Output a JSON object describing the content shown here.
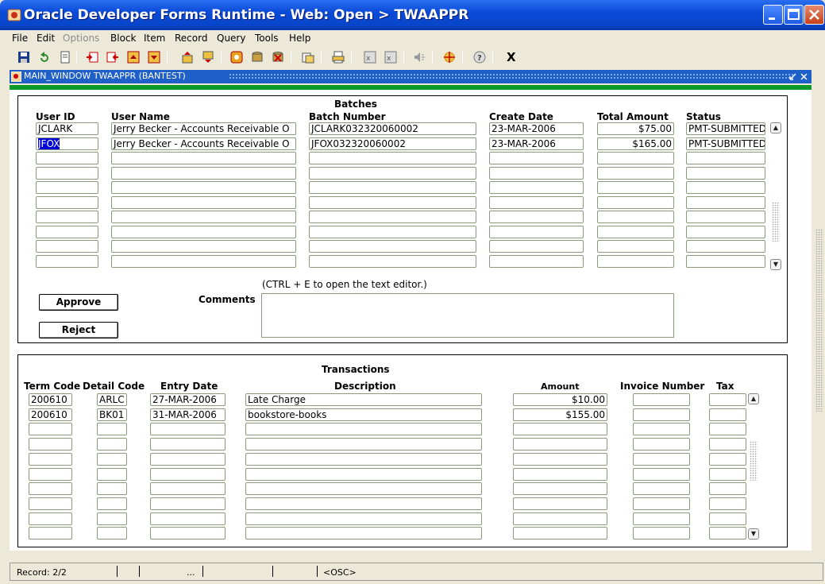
{
  "window": {
    "title": "Oracle Developer Forms Runtime - Web:  Open > TWAAPPR"
  },
  "menu": [
    "File",
    "Edit",
    "Options",
    "Block",
    "Item",
    "Record",
    "Query",
    "Tools",
    "Help"
  ],
  "menu_disabled": [
    "Options"
  ],
  "toolbar": {
    "exit_label": "X",
    "icons": [
      "save-icon",
      "rollback-icon",
      "print-icon",
      "enter-query-icon",
      "execute-query-icon",
      "cancel-query-icon",
      "previous-block-icon",
      "next-block-icon",
      "previous-record-icon",
      "next-record-icon",
      "insert-record-icon",
      "remove-record-icon",
      "lock-record-icon",
      "duplicate-item-icon",
      "duplicate-record-icon",
      "edit-icon",
      "list-values-icon",
      "audio-icon",
      "target-icon",
      "help-icon"
    ]
  },
  "inner_window": {
    "title": "MAIN_WINDOW  TWAAPPR  (BANTEST)"
  },
  "batches": {
    "title": "Batches",
    "headers": {
      "user_id": "User ID",
      "user_name": "User Name",
      "batch_number": "Batch Number",
      "create_date": "Create Date",
      "total_amount": "Total Amount",
      "status": "Status"
    },
    "rows": [
      {
        "user_id": "JCLARK",
        "user_name": "Jerry Becker - Accounts Receivable O",
        "batch_number": "JCLARK032320060002",
        "create_date": "23-MAR-2006",
        "total_amount": "$75.00",
        "status": "PMT-SUBMITTED"
      },
      {
        "user_id": "JFOX",
        "user_name": "Jerry Becker - Accounts Receivable O",
        "batch_number": "JFOX032320060002",
        "create_date": "23-MAR-2006",
        "total_amount": "$165.00",
        "status": "PMT-SUBMITTED"
      }
    ],
    "empty_rows": 8,
    "approve_label": "Approve",
    "reject_label": "Reject",
    "comments_label": "Comments",
    "comments_hint": "(CTRL + E to open the text editor.)",
    "comments_value": ""
  },
  "transactions": {
    "title": "Transactions",
    "headers": {
      "term_code": "Term Code",
      "detail_code": "Detail Code",
      "entry_date": "Entry Date",
      "description": "Description",
      "amount": "Amount",
      "invoice_number": "Invoice Number",
      "tax": "Tax"
    },
    "rows": [
      {
        "term_code": "200610",
        "detail_code": "ARLC",
        "entry_date": "27-MAR-2006",
        "description": "Late Charge",
        "amount": "$10.00",
        "invoice_number": "",
        "tax": ""
      },
      {
        "term_code": "200610",
        "detail_code": "BK01",
        "entry_date": "31-MAR-2006",
        "description": "bookstore-books",
        "amount": "$155.00",
        "invoice_number": "",
        "tax": ""
      }
    ],
    "empty_rows": 8
  },
  "status": {
    "record": "Record: 2/2",
    "ellipsis": "...",
    "mode": "<OSC>"
  }
}
